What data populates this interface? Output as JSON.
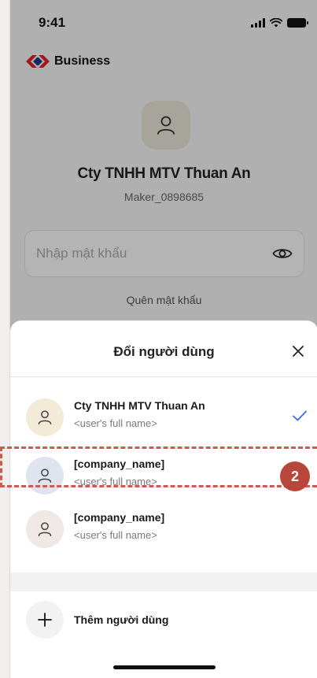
{
  "status_bar": {
    "time": "9:41"
  },
  "brand": {
    "name": "Business",
    "logo_color": "#e0252b"
  },
  "login": {
    "company_name": "Cty TNHH MTV Thuan An",
    "username": "Maker_0898685",
    "password_placeholder": "Nhập mật khẩu",
    "forgot_password": "Quên mật khẩu"
  },
  "sheet": {
    "title": "Đổi người dùng",
    "users": [
      {
        "name": "Cty TNHH MTV Thuan An",
        "full_name": "<user's full name>",
        "selected": true,
        "avatar_color": "#f3ead8"
      },
      {
        "name": "[company_name]",
        "full_name": "<user's full name>",
        "selected": false,
        "avatar_color": "#dfe5ef"
      },
      {
        "name": "[company_name]",
        "full_name": "<user's full name>",
        "selected": false,
        "avatar_color": "#efe8e4"
      }
    ],
    "add_user_label": "Thêm người dùng"
  },
  "annotation": {
    "step_number": "2",
    "color": "#b8463a"
  }
}
